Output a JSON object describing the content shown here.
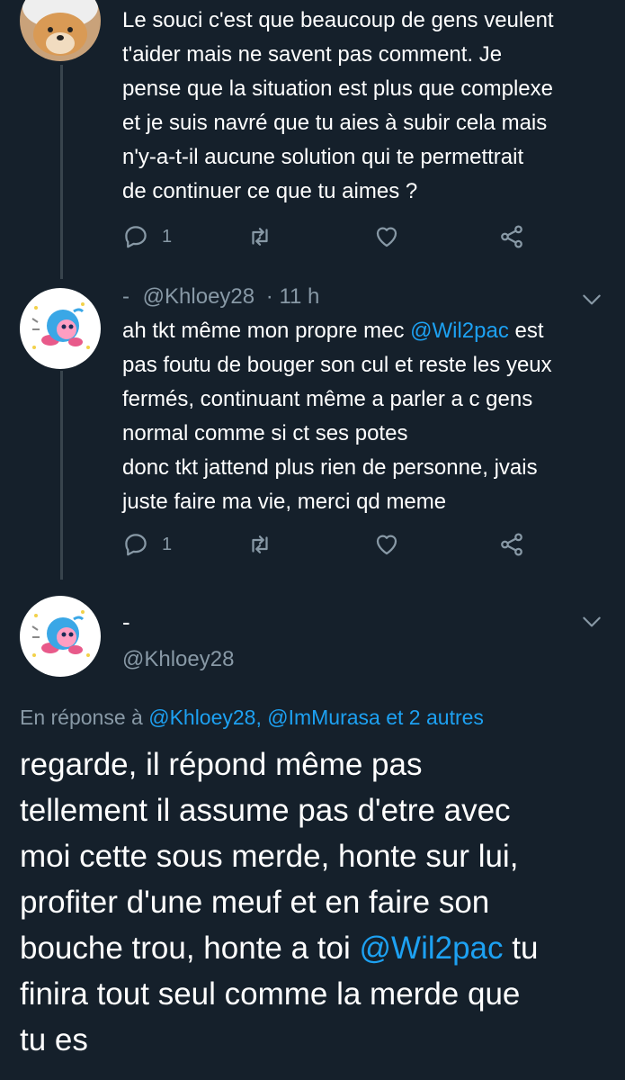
{
  "tweets": [
    {
      "avatar": "dog-avatar",
      "text_lines": [
        "Le souci c'est que beaucoup de gens veulent",
        "t'aider mais ne savent pas comment. Je",
        "pense que la situation est plus que complexe",
        "et je suis navré que tu aies à subir cela mais",
        "n'y-a-t-il aucune solution qui te permettrait",
        "de continuer ce que tu aimes ?"
      ],
      "reply_count": "1"
    },
    {
      "avatar": "kirby-avatar",
      "name": "-",
      "handle": "@Khloey28",
      "time": "· 11 h",
      "text_part1": "ah tkt même mon propre mec ",
      "mention": "@Wil2pac",
      "text_part2": " est",
      "text_lines": [
        "pas foutu de bouger son cul et reste les yeux",
        "fermés, continuant même a parler a c gens",
        "normal comme si ct ses potes",
        "donc tkt jattend plus rien de personne, jvais",
        "juste faire ma vie, merci qd meme"
      ],
      "reply_count": "1"
    }
  ],
  "main_tweet": {
    "name": "-",
    "handle": "@Khloey28",
    "reply_prefix": "En réponse à",
    "reply_mentions": "@Khloey28, @ImMurasa et 2 autres",
    "text_lines": [
      "regarde, il répond même pas",
      "tellement il assume pas d'etre avec",
      "moi cette sous merde, honte sur lui,",
      "profiter d'une meuf et en faire son"
    ],
    "line5_part1": "bouche trou, honte a toi ",
    "line5_mention": "@Wil2pac",
    "line5_part2": " tu",
    "text_lines_end": [
      "finira tout seul comme la merde que",
      "tu es"
    ]
  },
  "icons": [
    "reply-icon",
    "retweet-icon",
    "like-icon",
    "share-icon",
    "chevron-down-icon"
  ],
  "colors": {
    "background": "#15202b",
    "text": "#ffffff",
    "muted": "#8899a6",
    "link": "#1da1f2",
    "thread_line": "#38444d"
  }
}
